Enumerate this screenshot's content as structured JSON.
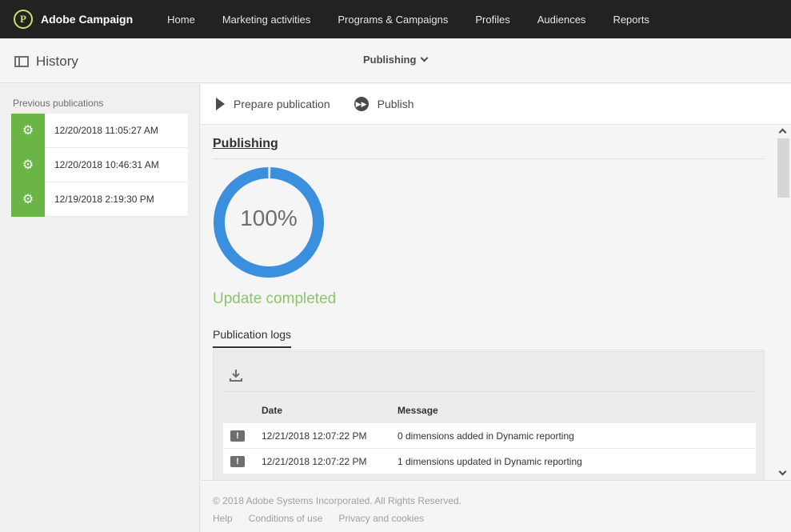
{
  "app": {
    "brand": "Adobe Campaign",
    "nav": [
      "Home",
      "Marketing activities",
      "Programs & Campaigns",
      "Profiles",
      "Audiences",
      "Reports"
    ]
  },
  "header": {
    "history_label": "History",
    "title": "Publishing"
  },
  "sidebar": {
    "title": "Previous publications",
    "items": [
      {
        "date": "12/20/2018 11:05:27 AM"
      },
      {
        "date": "12/20/2018 10:46:31 AM"
      },
      {
        "date": "12/19/2018 2:19:30 PM"
      }
    ]
  },
  "toolbar": {
    "prepare_label": "Prepare publication",
    "publish_label": "Publish"
  },
  "main": {
    "section_title": "Publishing",
    "progress_text": "100%",
    "progress_value": 1.0,
    "status": "Update completed",
    "logs_tab": "Publication logs",
    "logs_columns": {
      "date": "Date",
      "message": "Message"
    },
    "logs": [
      {
        "date": "12/21/2018 12:07:22 PM",
        "message": "0 dimensions added in Dynamic reporting"
      },
      {
        "date": "12/21/2018 12:07:22 PM",
        "message": "1 dimensions updated in Dynamic reporting"
      }
    ]
  },
  "footer": {
    "copyright": "© 2018 Adobe Systems Incorporated. All Rights Reserved.",
    "links": [
      "Help",
      "Conditions of use",
      "Privacy and cookies"
    ]
  },
  "colors": {
    "topbar": "#222222",
    "accent_green": "#6bb546",
    "progress_blue": "#3a8fde",
    "status_green": "#8fc36c"
  },
  "icons": {
    "brand": "adobe-campaign-logo",
    "history": "panel-icon",
    "prepare": "play-icon",
    "publish": "publish-icon",
    "pub_item": "gears-icon",
    "download": "download-icon",
    "log_row": "warning-icon"
  }
}
